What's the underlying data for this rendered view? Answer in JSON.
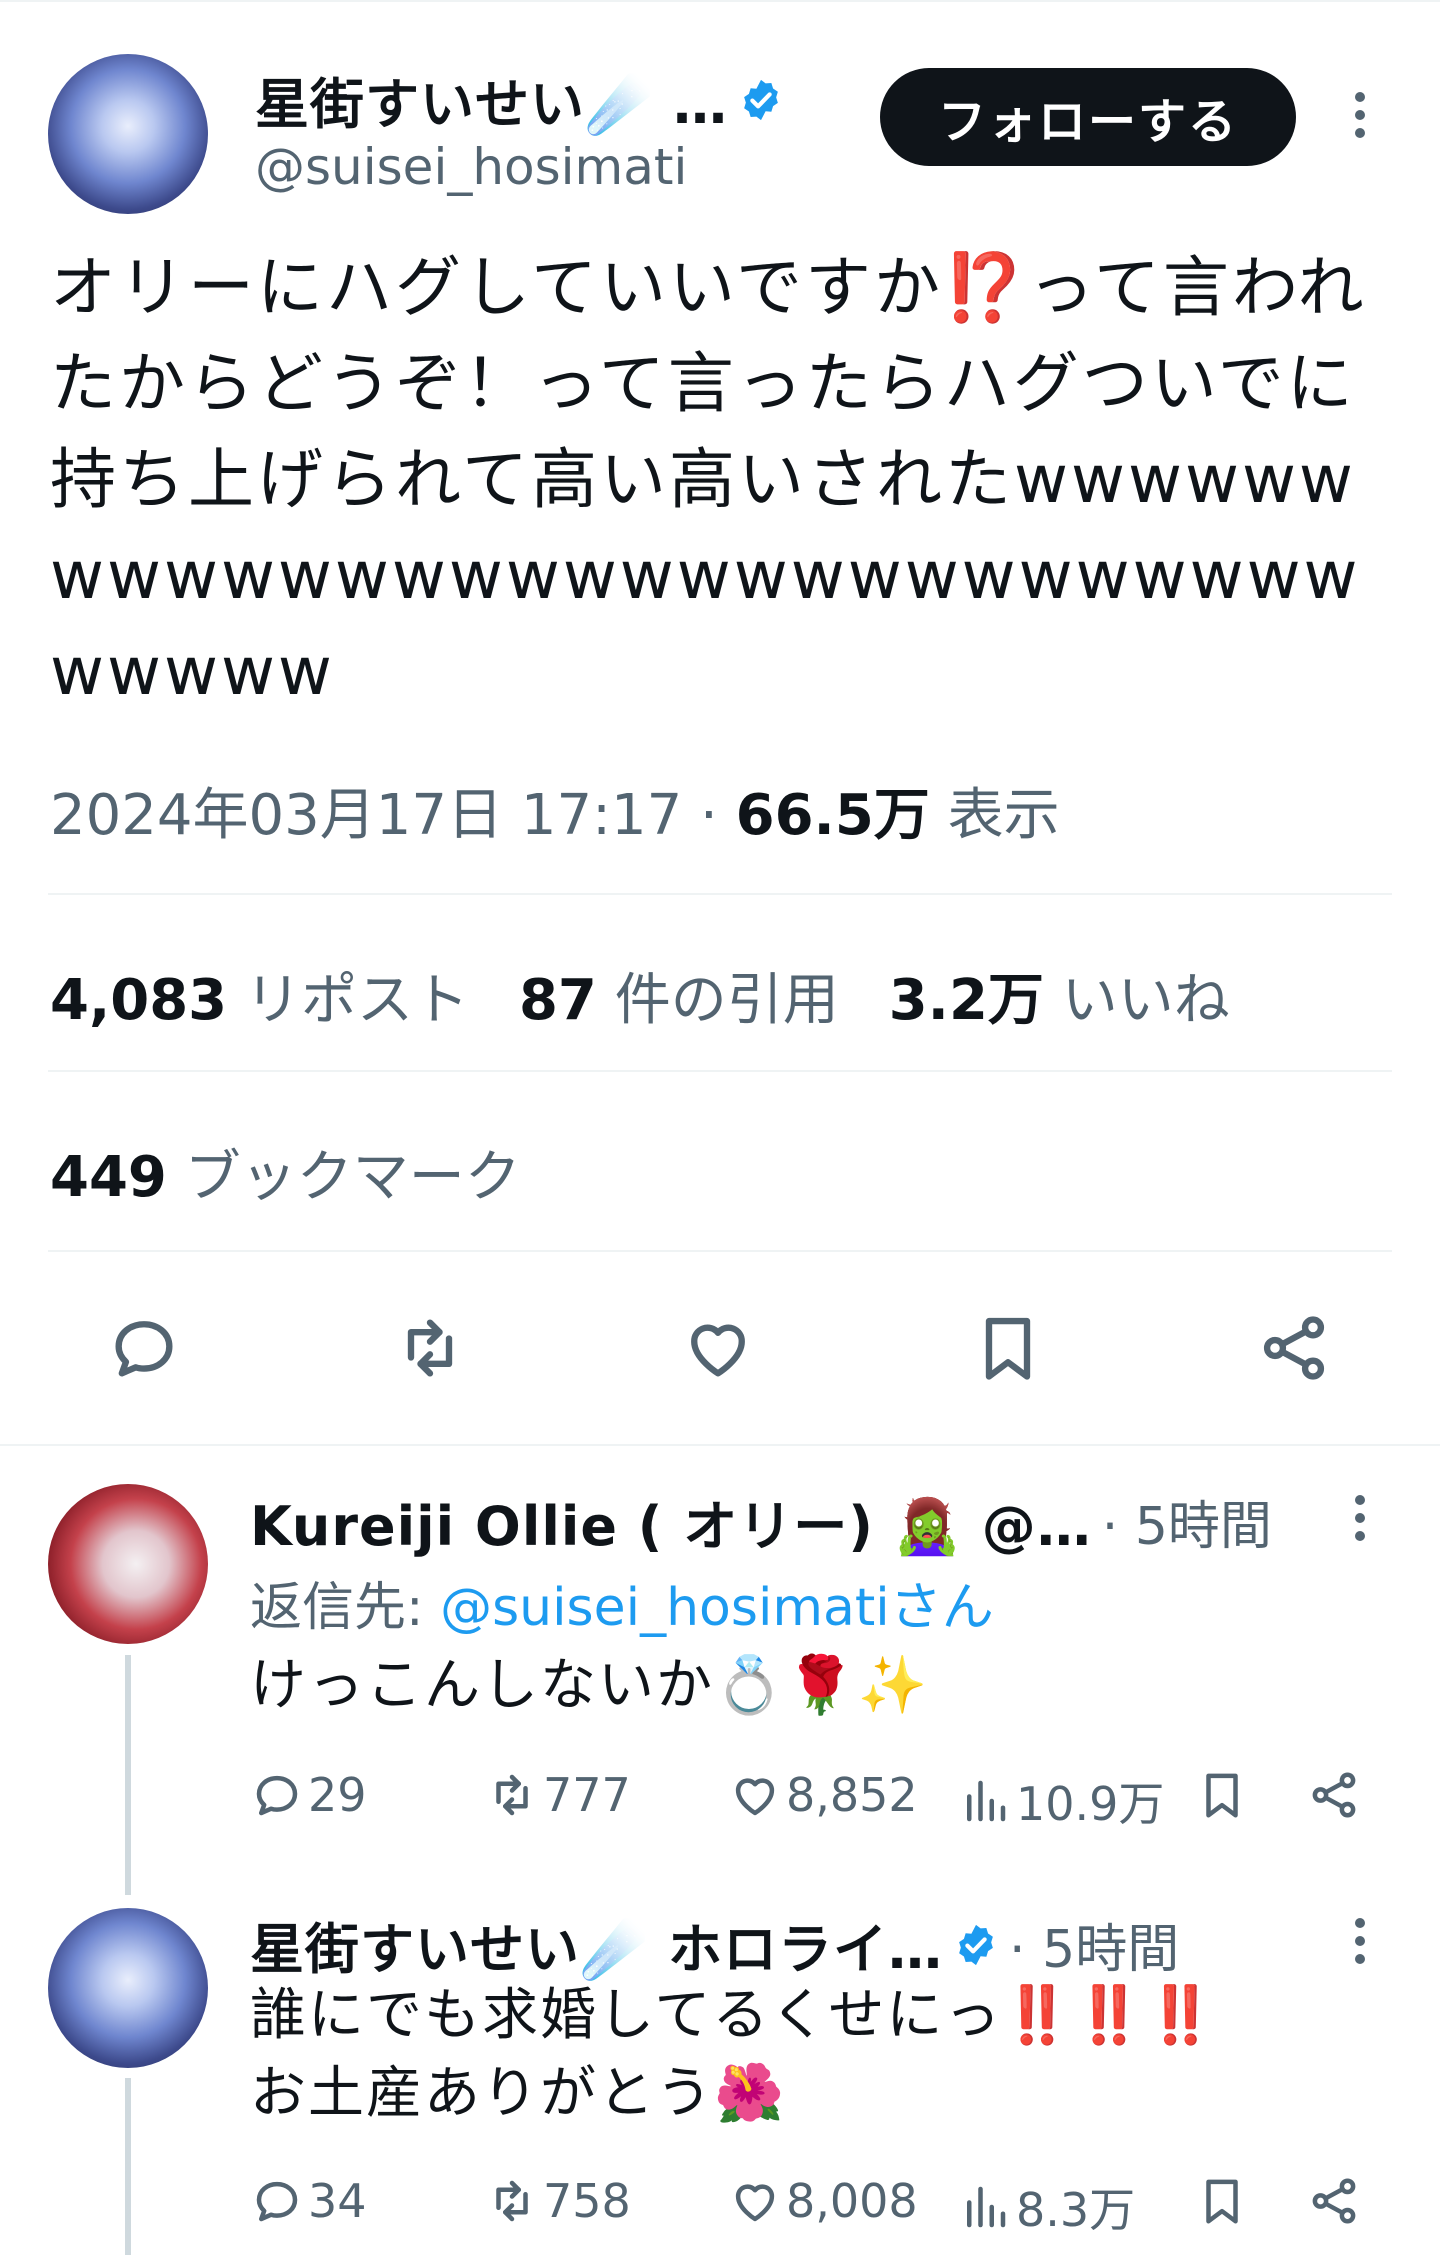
{
  "tweet": {
    "author_name": "星街すいせい☄️ …",
    "author_handle": "@suisei_hosimati",
    "follow_label": "フォローする",
    "text": "オリーにハグしていいですか⁉️って言われたからどうぞ！って言ったらハグついでに持ち上げられて高い高いされたwwwwwwwwwwwwwwwwwwwwwwwwwwwwwwwwww",
    "timestamp": "2024年03月17日 17:17",
    "separator": " · ",
    "views_count": "66.5万",
    "views_label": "表示"
  },
  "stats": {
    "reposts_count": "4,083",
    "reposts_label": "リポスト",
    "quotes_count": "87",
    "quotes_label": "件の引用",
    "likes_count": "3.2万",
    "likes_label": "いいね",
    "bookmarks_count": "449",
    "bookmarks_label": "ブックマーク"
  },
  "replies": [
    {
      "author_name": "Kureiji Ollie ( オリー) 🧟‍♀️ @…",
      "time": " · 5時間",
      "reply_to_prefix": "返信先: ",
      "reply_to_handle": "@suisei_hosimatiさん",
      "text": "けっこんしないか💍🌹✨",
      "replies": "29",
      "reposts": "777",
      "likes": "8,852",
      "views": "10.9万"
    },
    {
      "author_name": "星街すいせい☄️ ホロライ…",
      "time": " · 5時間",
      "text_line1": "誰にでも求婚してるくせにっ‼️‼️‼️",
      "text_line2": "お土産ありがとう🌺",
      "replies": "34",
      "reposts": "758",
      "likes": "8,008",
      "views": "8.3万"
    }
  ],
  "colors": {
    "text_primary": "#0f1419",
    "text_secondary": "#536471",
    "link": "#1d9bf0",
    "verified": "#1d9bf0",
    "divider": "#eff3f4"
  }
}
